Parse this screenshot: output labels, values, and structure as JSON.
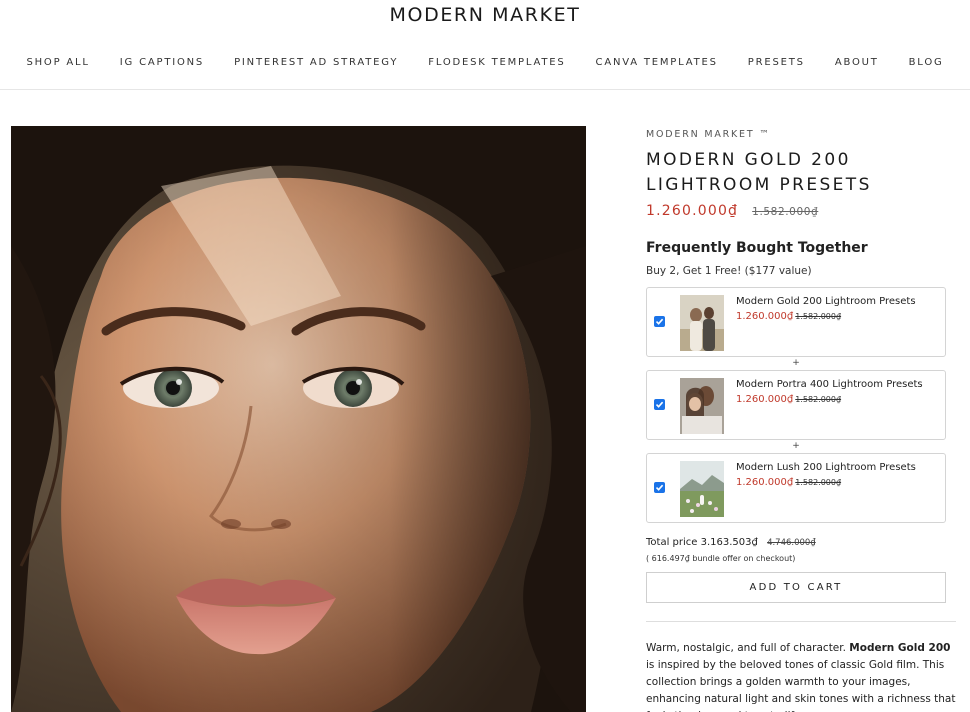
{
  "site": {
    "logo": "MODERN MARKET"
  },
  "nav": {
    "items": [
      {
        "label": "SHOP ALL"
      },
      {
        "label": "IG CAPTIONS"
      },
      {
        "label": "PINTEREST AD STRATEGY"
      },
      {
        "label": "FLODESK TEMPLATES"
      },
      {
        "label": "CANVA TEMPLATES"
      },
      {
        "label": "PRESETS"
      },
      {
        "label": "ABOUT"
      },
      {
        "label": "BLOG"
      }
    ]
  },
  "product": {
    "vendor": "MODERN MARKET ™",
    "title_line1": "MODERN GOLD 200",
    "title_line2": "LIGHTROOM PRESETS",
    "price": "1.260.000₫",
    "compare_price": "1.582.000₫"
  },
  "fbt": {
    "title": "Frequently Bought Together",
    "subtitle": "Buy 2, Get 1 Free! ($177 value)",
    "plus": "+",
    "items": [
      {
        "name": "Modern Gold 200 Lightroom Presets",
        "price": "1.260.000₫",
        "compare": "1.582.000₫",
        "checked": true,
        "thumb_icon": "couple-photo"
      },
      {
        "name": "Modern Portra 400 Lightroom Presets",
        "price": "1.260.000₫",
        "compare": "1.582.000₫",
        "checked": true,
        "thumb_icon": "couple-portrait-photo"
      },
      {
        "name": "Modern Lush 200 Lightroom Presets",
        "price": "1.260.000₫",
        "compare": "1.582.000₫",
        "checked": true,
        "thumb_icon": "meadow-landscape-photo"
      }
    ],
    "total_label": "Total price",
    "total": "3.163.503₫",
    "total_compare": "4.746.000₫",
    "bundle_note": "( 616.497₫ bundle offer on checkout)",
    "add_to_cart": "ADD TO CART"
  },
  "description": {
    "intro": "Warm, nostalgic, and full of character. ",
    "bold": "Modern Gold 200",
    "rest": " is inspired by the beloved tones of classic Gold film. This collection brings a golden warmth to your images, enhancing natural light and skin tones with a richness that feels timeless and true-to-life"
  },
  "colors": {
    "price_red": "#c0392b",
    "checkbox_blue": "#1a73e8",
    "border": "#d4d4d4"
  }
}
